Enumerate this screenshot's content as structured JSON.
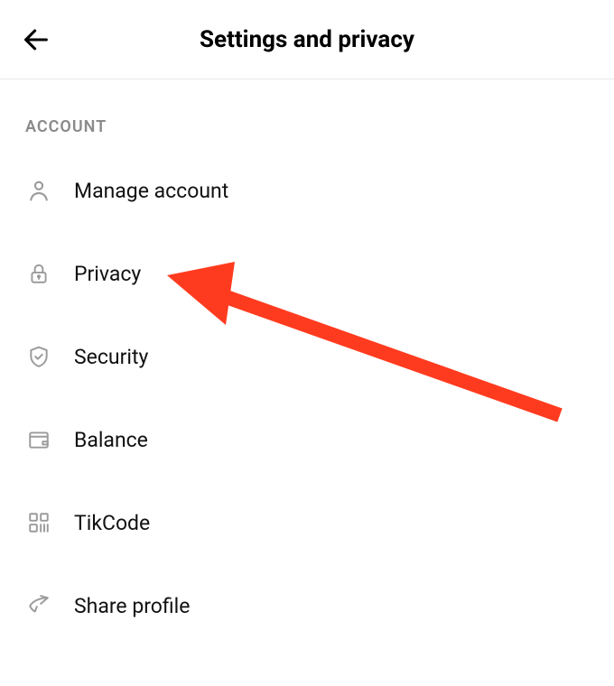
{
  "header": {
    "title": "Settings and privacy"
  },
  "section": {
    "label": "ACCOUNT"
  },
  "menu": {
    "items": [
      {
        "label": "Manage account",
        "icon": "person-icon"
      },
      {
        "label": "Privacy",
        "icon": "lock-icon"
      },
      {
        "label": "Security",
        "icon": "shield-icon"
      },
      {
        "label": "Balance",
        "icon": "wallet-icon"
      },
      {
        "label": "TikCode",
        "icon": "qrcode-icon"
      },
      {
        "label": "Share profile",
        "icon": "share-icon"
      }
    ]
  },
  "annotation": {
    "type": "arrow",
    "color": "#ff3b1f",
    "points_to": "sidebar-item-privacy"
  }
}
